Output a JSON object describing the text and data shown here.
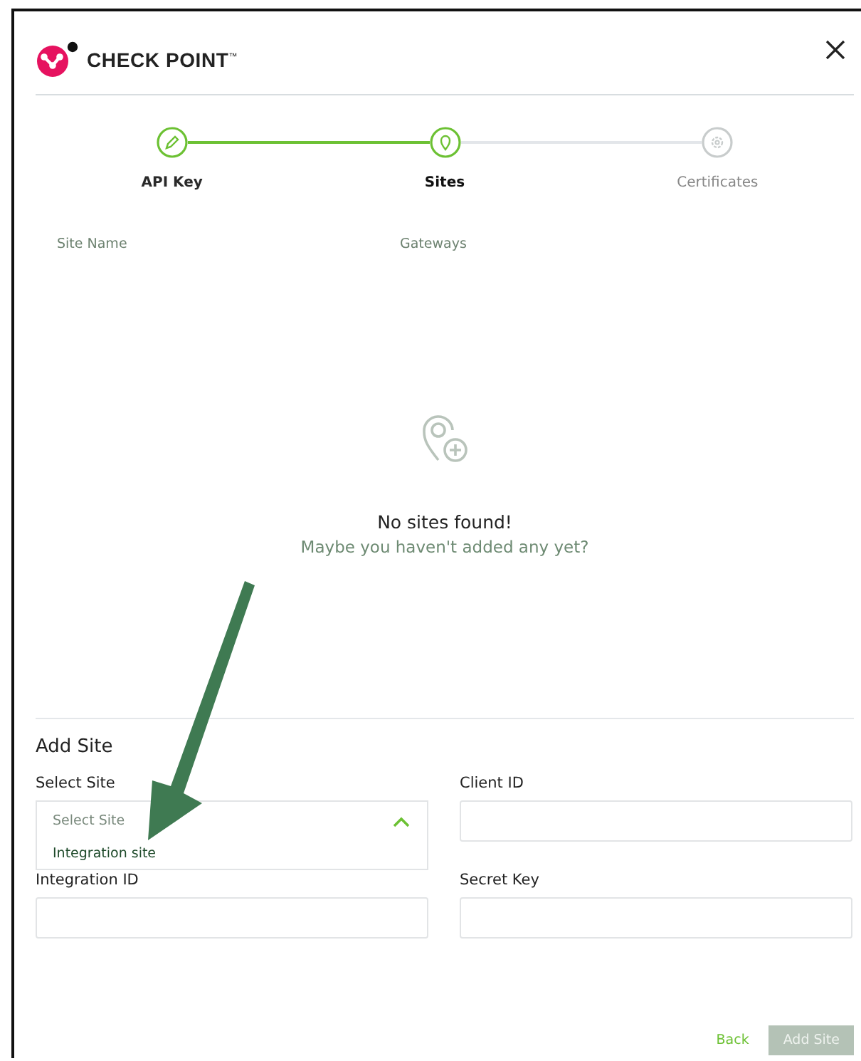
{
  "logo": {
    "text": "CHECK POINT",
    "trademark": "™"
  },
  "steps": [
    {
      "label": "API Key",
      "completed": true,
      "selected": false
    },
    {
      "label": "Sites",
      "completed": false,
      "selected": true
    },
    {
      "label": "Certificates",
      "completed": false,
      "selected": false
    }
  ],
  "table": {
    "columns": [
      "Site Name",
      "Gateways"
    ]
  },
  "empty_state": {
    "title": "No sites found!",
    "message": "Maybe you haven't added any yet?"
  },
  "form": {
    "title": "Add Site",
    "select_site": {
      "label": "Select Site",
      "placeholder": "Select Site",
      "expanded": true,
      "options": [
        "Integration site"
      ]
    },
    "client_id": {
      "label": "Client ID"
    },
    "integration_id": {
      "label": "Integration ID"
    },
    "secret_key": {
      "label": "Secret Key"
    }
  },
  "buttons": [
    {
      "label": "Back",
      "disabled": false
    },
    {
      "label": "Add Site",
      "disabled": true
    }
  ]
}
